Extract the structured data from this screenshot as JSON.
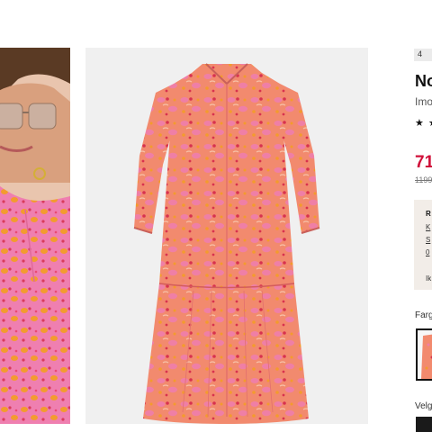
{
  "product": {
    "badge": "4",
    "title": "No",
    "brand": "Imo",
    "rating_stars": "★ ★",
    "price": "71",
    "old_price": "1199"
  },
  "promo": {
    "heading": "R",
    "lines": [
      "K",
      "S",
      "0"
    ],
    "footer": "Ik"
  },
  "options": {
    "color_label": "Farg",
    "size_label": "Velg"
  },
  "colors": {
    "price_red": "#d0103a",
    "dress_base": "#f28a6e",
    "dress_pink": "#ef7fa6",
    "print_orange": "#f39b2e"
  },
  "icons": {
    "rating": "star-icon"
  }
}
